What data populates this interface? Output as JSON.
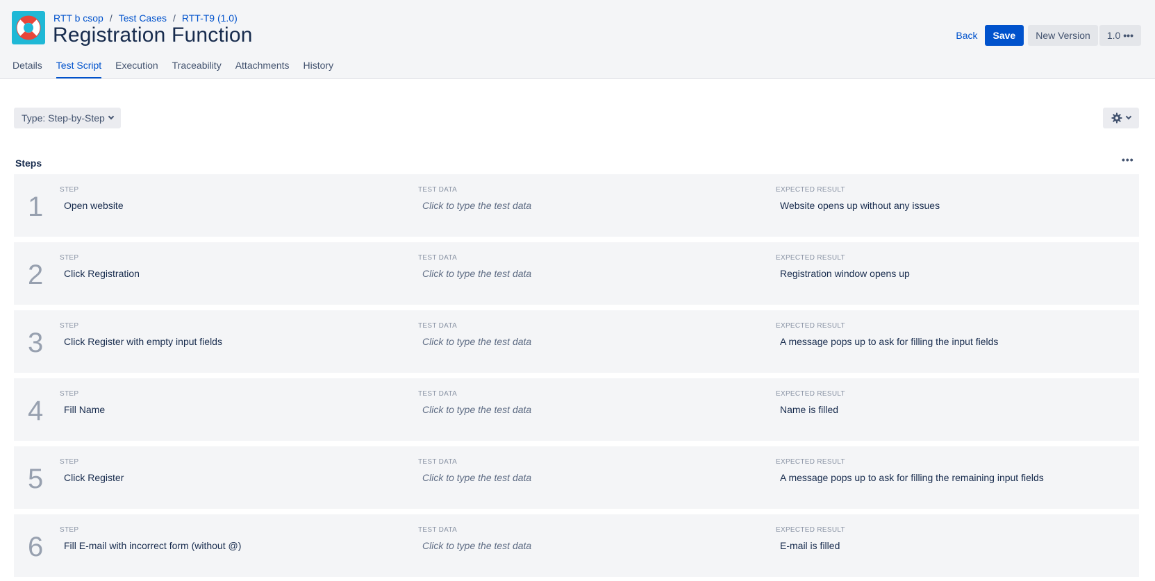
{
  "breadcrumb": {
    "project": "RTT b csop",
    "section": "Test Cases",
    "item": "RTT-T9 (1.0)",
    "separator": "/"
  },
  "title": "Registration Function",
  "actions": {
    "back": "Back",
    "save": "Save",
    "new_version": "New Version",
    "version": "1.0",
    "more": "•••"
  },
  "tabs": [
    {
      "label": "Details"
    },
    {
      "label": "Test Script",
      "active": true
    },
    {
      "label": "Execution"
    },
    {
      "label": "Traceability"
    },
    {
      "label": "Attachments"
    },
    {
      "label": "History"
    }
  ],
  "type_select": {
    "label": "Type: Step-by-Step"
  },
  "steps": {
    "title": "Steps",
    "more": "•••",
    "col_step": "Step",
    "col_test_data": "Test Data",
    "col_expected": "Expected Result",
    "rows": [
      {
        "num": "1",
        "step": "Open website",
        "test_data": "Click to type the test data",
        "expected": "Website opens up without any issues"
      },
      {
        "num": "2",
        "step": "Click Registration",
        "test_data": "Click to type the test data",
        "expected": "Registration window opens up"
      },
      {
        "num": "3",
        "step": "Click Register with empty input fields",
        "test_data": "Click to type the test data",
        "expected": "A message pops up to ask for filling the input fields"
      },
      {
        "num": "4",
        "step": "Fill Name",
        "test_data": "Click to type the test data",
        "expected": "Name is filled"
      },
      {
        "num": "5",
        "step": "Click Register",
        "test_data": "Click to type the test data",
        "expected": "A message pops up to ask for filling the remaining input fields"
      },
      {
        "num": "6",
        "step": "Fill E-mail with incorrect form (without @)",
        "test_data": "Click to type the test data",
        "expected": "E-mail is filled"
      }
    ]
  },
  "colors": {
    "primary": "#0052cc",
    "header_bg": "#f4f5f7",
    "logo_bg": "#1fb8d6",
    "lifebuoy": "#e8463a",
    "row_bg": "#f4f5f7"
  },
  "icons": {
    "logo": "lifebuoy-icon",
    "gear": "gear-icon",
    "chevron": "chevron-down-icon",
    "more": "more-icon"
  }
}
